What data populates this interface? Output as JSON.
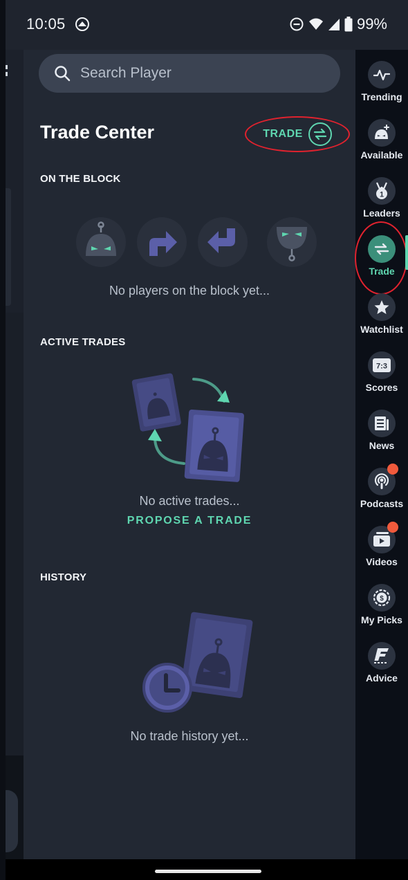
{
  "status_bar": {
    "time": "10:05",
    "battery": "99%",
    "icons": [
      "app-notification-icon",
      "do-not-disturb-icon",
      "wifi-icon",
      "signal-icon",
      "battery-icon"
    ]
  },
  "search": {
    "placeholder": "Search Player",
    "value": ""
  },
  "header": {
    "title": "Trade Center",
    "trade_button_label": "TRADE"
  },
  "on_the_block": {
    "heading": "ON THE BLOCK",
    "empty_text": "No players on the block yet..."
  },
  "active_trades": {
    "heading": "ACTIVE TRADES",
    "empty_text": "No active trades...",
    "propose_label": "PROPOSE A TRADE"
  },
  "history": {
    "heading": "HISTORY",
    "empty_text": "No trade history yet..."
  },
  "rail": {
    "items": [
      {
        "label": "Trending",
        "icon": "pulse-icon"
      },
      {
        "label": "Available",
        "icon": "add-player-icon"
      },
      {
        "label": "Leaders",
        "icon": "medal-icon"
      },
      {
        "label": "Trade",
        "icon": "trade-arrows-icon",
        "active": true
      },
      {
        "label": "Watchlist",
        "icon": "star-icon"
      },
      {
        "label": "Scores",
        "icon": "scoreboard-icon",
        "badge_text": "7:3"
      },
      {
        "label": "News",
        "icon": "newspaper-icon"
      },
      {
        "label": "Podcasts",
        "icon": "podcast-icon",
        "notification": true
      },
      {
        "label": "Videos",
        "icon": "video-icon",
        "notification": true
      },
      {
        "label": "My Picks",
        "icon": "picks-coin-icon"
      },
      {
        "label": "Advice",
        "icon": "advice-logo-icon"
      }
    ]
  },
  "colors": {
    "accent": "#5fd6b0",
    "panel": "#222833",
    "rail": "#0b0f17",
    "annotation": "#e0222e",
    "notification": "#f05a3c"
  }
}
